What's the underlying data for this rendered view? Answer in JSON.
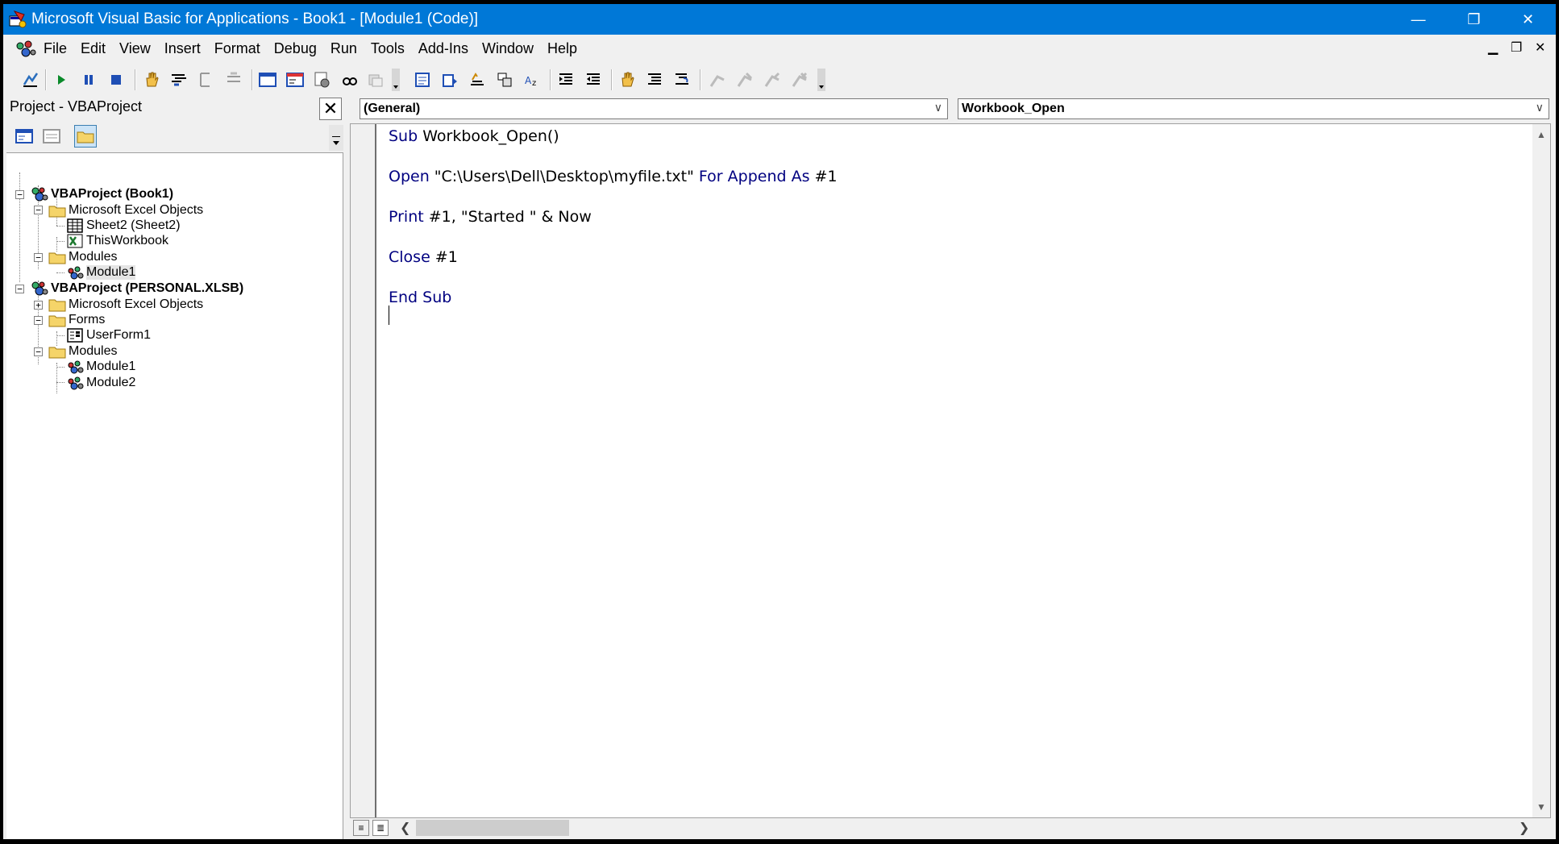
{
  "window": {
    "title": "Microsoft Visual Basic for Applications - Book1 - [Module1 (Code)]",
    "minimize": "—",
    "restore": "❐",
    "close": "✕",
    "accent": "#0078d7"
  },
  "menu": {
    "items": [
      "File",
      "Edit",
      "View",
      "Insert",
      "Format",
      "Debug",
      "Run",
      "Tools",
      "Add-Ins",
      "Window",
      "Help"
    ],
    "mdi_minimize": "▁",
    "mdi_restore": "❐",
    "mdi_close": "✕"
  },
  "project": {
    "title": "Project - VBAProject",
    "close": "✕",
    "tree": [
      {
        "label": "VBAProject (Book1)",
        "icon": "vbaproject-icon"
      },
      {
        "label": "Microsoft Excel Objects",
        "icon": "folder-icon"
      },
      {
        "label": "Sheet2 (Sheet2)",
        "icon": "sheet-icon"
      },
      {
        "label": "ThisWorkbook",
        "icon": "workbook-icon"
      },
      {
        "label": "Modules",
        "icon": "folder-icon"
      },
      {
        "label": "Module1",
        "icon": "module-icon"
      },
      {
        "label": "VBAProject (PERSONAL.XLSB)",
        "icon": "vbaproject-icon"
      },
      {
        "label": "Microsoft Excel Objects",
        "icon": "folder-icon"
      },
      {
        "label": "Forms",
        "icon": "folder-icon"
      },
      {
        "label": "UserForm1",
        "icon": "userform-icon"
      },
      {
        "label": "Modules",
        "icon": "folder-icon"
      },
      {
        "label": "Module1",
        "icon": "module-icon"
      },
      {
        "label": "Module2",
        "icon": "module-icon"
      }
    ]
  },
  "code": {
    "object_combo": "(General)",
    "procedure_combo": "Workbook_Open",
    "lines": {
      "l1_kw": "Sub",
      "l1_rest": " Workbook_Open()",
      "l2_kw1": "Open",
      "l2_mid": " \"C:\\Users\\Dell\\Desktop\\myfile.txt\" ",
      "l2_kw2": "For Append As",
      "l2_rest": " #1",
      "l3_kw": "Print",
      "l3_rest": " #1, \"Started \" & Now",
      "l4_kw": "Close",
      "l4_rest": " #1",
      "l5_kw": "End Sub"
    },
    "keyword_color": "#000080"
  }
}
